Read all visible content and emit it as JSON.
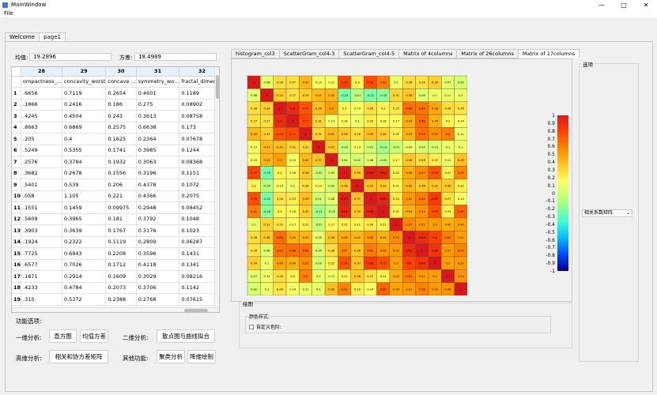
{
  "window": {
    "title": "MainWindow",
    "minimize": "—",
    "maximize": "□",
    "close": "✕"
  },
  "menu": {
    "file": "File"
  },
  "tabs": [
    "Welcome",
    "page1"
  ],
  "stats": {
    "mean_label": "均值:",
    "mean_value": "19.2896",
    "var_label": "方差:",
    "var_value": "18.4989"
  },
  "table": {
    "col_numbers": [
      "28",
      "29",
      "30",
      "31",
      "32"
    ],
    "col_names": [
      "ompactness_...",
      "concavity_worst",
      "concave ...",
      "symmetry_wo...",
      "fractal_dimens..."
    ],
    "rows": [
      [
        "1",
        ".6656",
        "0.7119",
        "0.2654",
        "0.4601",
        "0.1189"
      ],
      [
        "2",
        ".1866",
        "0.2416",
        "0.186",
        "0.275",
        "0.08902"
      ],
      [
        "3",
        ".4245",
        "0.4504",
        "0.243",
        "0.3613",
        "0.08758"
      ],
      [
        "4",
        ".8663",
        "0.6869",
        "0.2575",
        "0.6638",
        "0.173"
      ],
      [
        "5",
        ".205",
        "0.4",
        "0.1625",
        "0.2364",
        "0.07678"
      ],
      [
        "6",
        ".5249",
        "0.5355",
        "0.1741",
        "0.3985",
        "0.1244"
      ],
      [
        "7",
        ".2576",
        "0.3784",
        "0.1932",
        "0.3063",
        "0.08368"
      ],
      [
        "8",
        ".3682",
        "0.2678",
        "0.1556",
        "0.3196",
        "0.1151"
      ],
      [
        "9",
        ".5401",
        "0.539",
        "0.206",
        "0.4378",
        "0.1072"
      ],
      [
        "10",
        ".058",
        "1.105",
        "0.221",
        "0.4366",
        "0.2075"
      ],
      [
        "11",
        ".1551",
        "0.1459",
        "0.09975",
        "0.2948",
        "0.08452"
      ],
      [
        "12",
        ".5609",
        "0.3965",
        "0.181",
        "0.3792",
        "0.1048"
      ],
      [
        "13",
        ".3903",
        "0.3639",
        "0.1767",
        "0.3176",
        "0.1023"
      ],
      [
        "14",
        ".1924",
        "0.2322",
        "0.1119",
        "0.2809",
        "0.06287"
      ],
      [
        "15",
        ".7725",
        "0.6943",
        "0.2208",
        "0.3596",
        "0.1431"
      ],
      [
        "16",
        ".6577",
        "0.7026",
        "0.1712",
        "0.4218",
        "0.1341"
      ],
      [
        "17",
        ".1871",
        "0.2914",
        "0.1609",
        "0.3029",
        "0.08216"
      ],
      [
        "18",
        ".4233",
        "0.4784",
        "0.2073",
        "0.3706",
        "0.1142"
      ],
      [
        "19",
        ".315",
        "0.5372",
        "0.2388",
        "0.2768",
        "0.07615"
      ],
      [
        "20",
        ".1288",
        "0.2411",
        "0.1088",
        "0.2716",
        "0.06914"
      ]
    ]
  },
  "functions": {
    "title": "功能选项:",
    "one_dim_label": "一维分析:",
    "histogram_btn": "直方图",
    "mean_var_btn": "均值方差",
    "two_dim_label": "二维分析:",
    "scatter_btn": "散点图与曲线拟合",
    "high_dim_label": "高维分析:",
    "corr_btn": "相关和协方差矩阵",
    "other_label": "其他功能:",
    "cluster_btn": "聚类分析",
    "reduce_btn": "降维绘制"
  },
  "chart_tabs": [
    "histogram_col3",
    "ScatterGram_col4-3",
    "ScatterGram_col4-5",
    "Matrix of 4columns",
    "Matrix of 26columns",
    "Matrix of 17columns"
  ],
  "colorbar_ticks": [
    "1",
    "0.9",
    "0.8",
    "0.7",
    "0.6",
    "0.5",
    "0.4",
    "0.3",
    "0.2",
    "0.1",
    "0",
    "-0.1",
    "-0.2",
    "-0.3",
    "-0.4",
    "-0.5",
    "-0.6",
    "-0.7",
    "-0.8",
    "-0.9",
    "-1"
  ],
  "options": {
    "legend": "选项",
    "select_value": "相关系数矩阵"
  },
  "plot": {
    "legend": "绘图",
    "color_style": "颜色样式:",
    "custom_color": "自定义色阶:"
  },
  "chart_data": {
    "type": "heatmap",
    "title": "",
    "size": 17,
    "values": [
      [
        1,
        0.08,
        0.28,
        0.27,
        0.42,
        0.13,
        0.15,
        0.79,
        0.2,
        0.76,
        0.61,
        0.1,
        0.28,
        0.26,
        0.34,
        0.07,
        0.02
      ],
      [
        0.08,
        1,
        0.34,
        0.27,
        0.33,
        0.41,
        0.43,
        -0.23,
        -0.07,
        -0.22,
        -0.18,
        0.31,
        0.36,
        0.06,
        0.1,
        0.11,
        0.1
      ],
      [
        0.28,
        0.34,
        1,
        0.9,
        0.74,
        0.39,
        0.5,
        0.2,
        0.14,
        0.26,
        0.2,
        0.25,
        0.66,
        0.64,
        0.48,
        0.28,
        0.26
      ],
      [
        0.27,
        0.27,
        0.9,
        1,
        0.77,
        0.31,
        0.13,
        0.18,
        0.1,
        0.23,
        0.18,
        0.17,
        0.45,
        0.66,
        0.44,
        0.2,
        0.14
      ],
      [
        0.42,
        0.33,
        0.74,
        0.77,
        1,
        0.31,
        0.41,
        0.36,
        0.28,
        0.39,
        0.34,
        0.22,
        0.43,
        0.65,
        0.55,
        0.6,
        0.11
      ],
      [
        0.13,
        0.41,
        0.39,
        0.31,
        0.31,
        1,
        0.37,
        -0.02,
        0.13,
        0.01,
        -0.13,
        -0.01,
        0.09,
        0.04,
        0.03,
        0.1,
        0.1
      ],
      [
        0.15,
        0.43,
        0.5,
        0.13,
        0.41,
        0.37,
        1,
        0.04,
        0.02,
        0.08,
        -0.02,
        0.17,
        0.36,
        0.28,
        0.22,
        0.11,
        0.39
      ],
      [
        0.79,
        -0.23,
        0.2,
        0.18,
        0.36,
        -0.02,
        0.04,
        1,
        0.36,
        0.97,
        0.94,
        0.22,
        0.46,
        0.57,
        0.74,
        0.21,
        0.59
      ],
      [
        0.2,
        -0.07,
        0.14,
        0.1,
        0.28,
        0.13,
        0.02,
        0.36,
        1,
        0.37,
        0.35,
        0.21,
        0.42,
        0.36,
        0.37,
        0.36,
        0.22
      ],
      [
        0.76,
        -0.22,
        0.26,
        0.23,
        0.39,
        0.01,
        0.08,
        0.97,
        0.37,
        1,
        0.94,
        0.24,
        0.52,
        0.62,
        0.83,
        0.27,
        0.14
      ],
      [
        0.61,
        -0.18,
        0.2,
        0.18,
        0.34,
        -0.13,
        -0.02,
        0.94,
        0.35,
        0.94,
        1,
        0.21,
        0.44,
        0.54,
        0.75,
        0.21,
        0.69
      ],
      [
        0.1,
        0.31,
        0.25,
        0.17,
        0.22,
        -0.01,
        0.17,
        0.22,
        0.21,
        0.24,
        0.21,
        1,
        0.57,
        0.52,
        0.5,
        0.45,
        0.49
      ],
      [
        0.28,
        0.36,
        0.66,
        0.45,
        0.43,
        0.09,
        0.36,
        0.46,
        0.42,
        0.52,
        0.44,
        0.57,
        1,
        0.89,
        0.8,
        0.61,
        0.51
      ],
      [
        0.26,
        0.06,
        0.64,
        0.66,
        0.65,
        0.04,
        0.28,
        0.57,
        0.36,
        0.62,
        0.54,
        0.52,
        0.89,
        1,
        0.86,
        0.51,
        0.59
      ],
      [
        0.34,
        0.1,
        0.48,
        0.44,
        0.55,
        0.03,
        0.22,
        0.74,
        0.37,
        0.83,
        0.75,
        0.5,
        0.8,
        0.86,
        1,
        0.5,
        0.52
      ],
      [
        0.07,
        0.11,
        0.28,
        0.2,
        0.6,
        0.1,
        0.11,
        0.21,
        0.36,
        0.27,
        0.21,
        0.45,
        0.61,
        0.51,
        0.5,
        1,
        0.54
      ],
      [
        0.02,
        0.1,
        0.26,
        0.14,
        0.11,
        0.1,
        0.39,
        0.59,
        0.22,
        0.14,
        0.69,
        0.49,
        0.51,
        0.59,
        0.52,
        0.54,
        1
      ]
    ],
    "colorbar_range": [
      -1,
      1
    ],
    "colormap": "jet"
  }
}
